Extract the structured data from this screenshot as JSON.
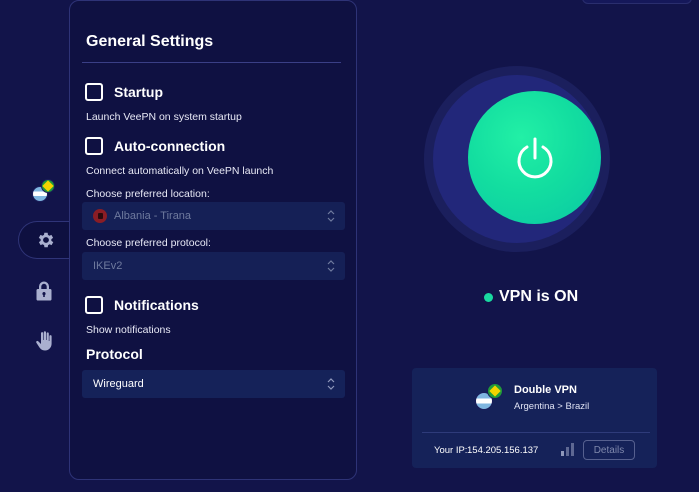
{
  "panel": {
    "title": "General Settings",
    "startup": {
      "label": "Startup",
      "description": "Launch VeePN on system startup",
      "checked": false
    },
    "auto_connection": {
      "label": "Auto-connection",
      "description": "Connect automatically on VeePN launch",
      "checked": false
    },
    "location": {
      "label": "Choose preferred location:",
      "value": "Albania - Tirana"
    },
    "protocol_pref": {
      "label": "Choose preferred protocol:",
      "value": "IKEv2"
    },
    "notifications": {
      "label": "Notifications",
      "description": "Show notifications",
      "checked": false
    },
    "protocol_section": {
      "title": "Protocol",
      "value": "Wireguard"
    }
  },
  "rail": {
    "items": [
      {
        "icon": "double-vpn-flags-icon"
      },
      {
        "icon": "gear-icon",
        "active": true
      },
      {
        "icon": "lock-icon"
      },
      {
        "icon": "hand-stop-icon"
      }
    ]
  },
  "vpn": {
    "status": "VPN is ON",
    "status_color": "#19d9a0",
    "accent": "#13dea0"
  },
  "card": {
    "name": "Double VPN",
    "route": "Argentina > Brazil",
    "ip_label": "Your IP:",
    "ip_value": "154.205.156.137",
    "details_label": "Details"
  }
}
